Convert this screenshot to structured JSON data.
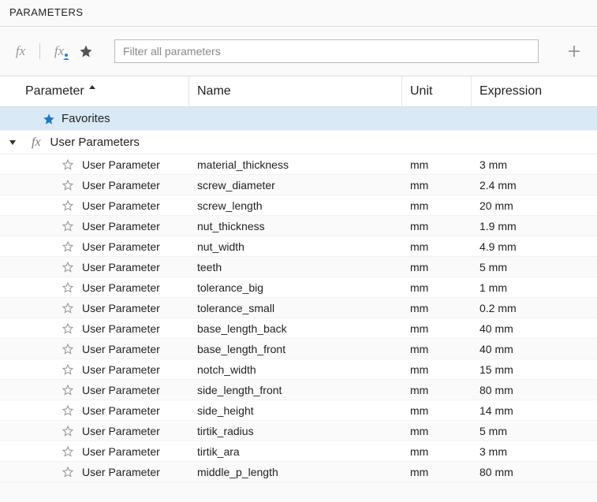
{
  "panel_title": "PARAMETERS",
  "filter_placeholder": "Filter all parameters",
  "columns": {
    "parameter": "Parameter",
    "name": "Name",
    "unit": "Unit",
    "expression": "Expression"
  },
  "sections": {
    "favorites_label": "Favorites",
    "user_params_label": "User Parameters"
  },
  "row_type_label": "User Parameter",
  "rows": [
    {
      "name": "material_thickness",
      "unit": "mm",
      "expr": "3 mm"
    },
    {
      "name": "screw_diameter",
      "unit": "mm",
      "expr": "2.4 mm"
    },
    {
      "name": "screw_length",
      "unit": "mm",
      "expr": "20 mm"
    },
    {
      "name": "nut_thickness",
      "unit": "mm",
      "expr": "1.9 mm"
    },
    {
      "name": "nut_width",
      "unit": "mm",
      "expr": "4.9 mm"
    },
    {
      "name": "teeth",
      "unit": "mm",
      "expr": "5 mm"
    },
    {
      "name": "tolerance_big",
      "unit": "mm",
      "expr": "1 mm"
    },
    {
      "name": "tolerance_small",
      "unit": "mm",
      "expr": "0.2 mm"
    },
    {
      "name": "base_length_back",
      "unit": "mm",
      "expr": "40 mm"
    },
    {
      "name": "base_length_front",
      "unit": "mm",
      "expr": "40 mm"
    },
    {
      "name": "notch_width",
      "unit": "mm",
      "expr": "15 mm"
    },
    {
      "name": "side_length_front",
      "unit": "mm",
      "expr": "80 mm"
    },
    {
      "name": "side_height",
      "unit": "mm",
      "expr": "14 mm"
    },
    {
      "name": "tirtik_radius",
      "unit": "mm",
      "expr": "5 mm"
    },
    {
      "name": "tirtik_ara",
      "unit": "mm",
      "expr": "3 mm"
    },
    {
      "name": "middle_p_length",
      "unit": "mm",
      "expr": "80 mm"
    }
  ]
}
